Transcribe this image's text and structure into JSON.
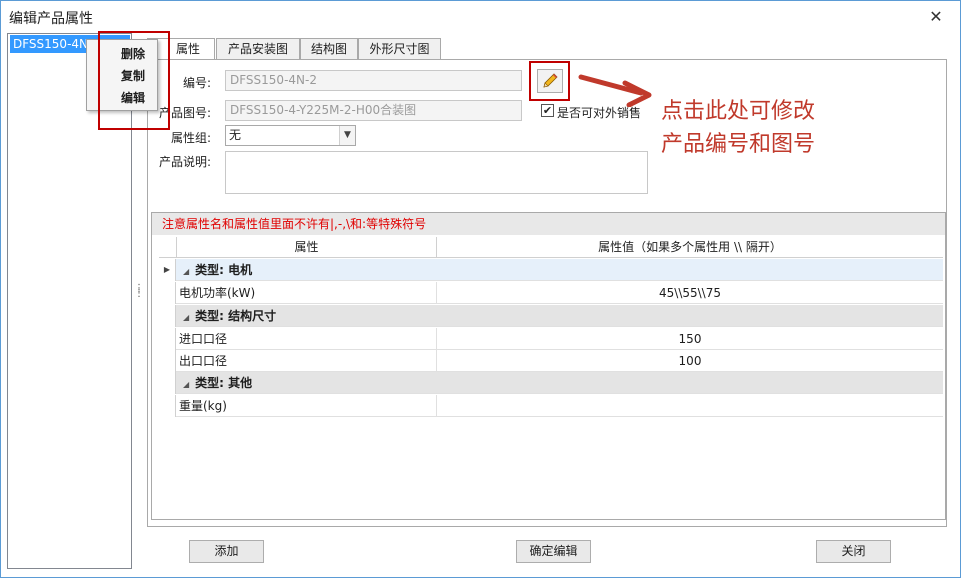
{
  "window": {
    "title": "编辑产品属性",
    "close_label": "✕"
  },
  "left_list": {
    "items": [
      {
        "label": "DFSS150-4N-2"
      }
    ]
  },
  "context_menu": {
    "items": [
      {
        "label": "删除"
      },
      {
        "label": "复制"
      },
      {
        "label": "编辑"
      }
    ]
  },
  "tabs": [
    {
      "label": "属性"
    },
    {
      "label": "产品安装图"
    },
    {
      "label": "结构图"
    },
    {
      "label": "外形尺寸图"
    }
  ],
  "form": {
    "code_label": "编号:",
    "code_value": "DFSS150-4N-2",
    "drawing_label": "产品图号:",
    "drawing_value": "DFSS150-4-Y225M-2-H00合装图",
    "external_sale_label": "是否可对外销售",
    "external_sale_checked": "✔",
    "attr_group_label": "属性组:",
    "attr_group_value": "无",
    "description_label": "产品说明:"
  },
  "annotation": {
    "line1": "点击此处可修改",
    "line2": "产品编号和图号",
    "color": "#c0392b"
  },
  "grid": {
    "notice": "注意属性名和属性值里面不许有|,-,\\和:等特殊符号",
    "columns": {
      "name": "属性",
      "value": "属性值（如果多个属性用 \\\\ 隔开）"
    },
    "groups": [
      {
        "title": "类型: 电机",
        "rows": [
          {
            "name": "电机功率(kW)",
            "value": "45\\\\55\\\\75"
          }
        ]
      },
      {
        "title": "类型: 结构尺寸",
        "rows": [
          {
            "name": "进口口径",
            "value": "150"
          },
          {
            "name": "出口口径",
            "value": "100"
          }
        ]
      },
      {
        "title": "类型: 其他",
        "rows": [
          {
            "name": "重量(kg)",
            "value": ""
          }
        ]
      }
    ]
  },
  "buttons": {
    "add": "添加",
    "confirm_edit": "确定编辑",
    "close": "关闭"
  },
  "colors": {
    "highlight_box": "#c00000",
    "selection": "#3399ff",
    "notice_text": "#e00000"
  }
}
